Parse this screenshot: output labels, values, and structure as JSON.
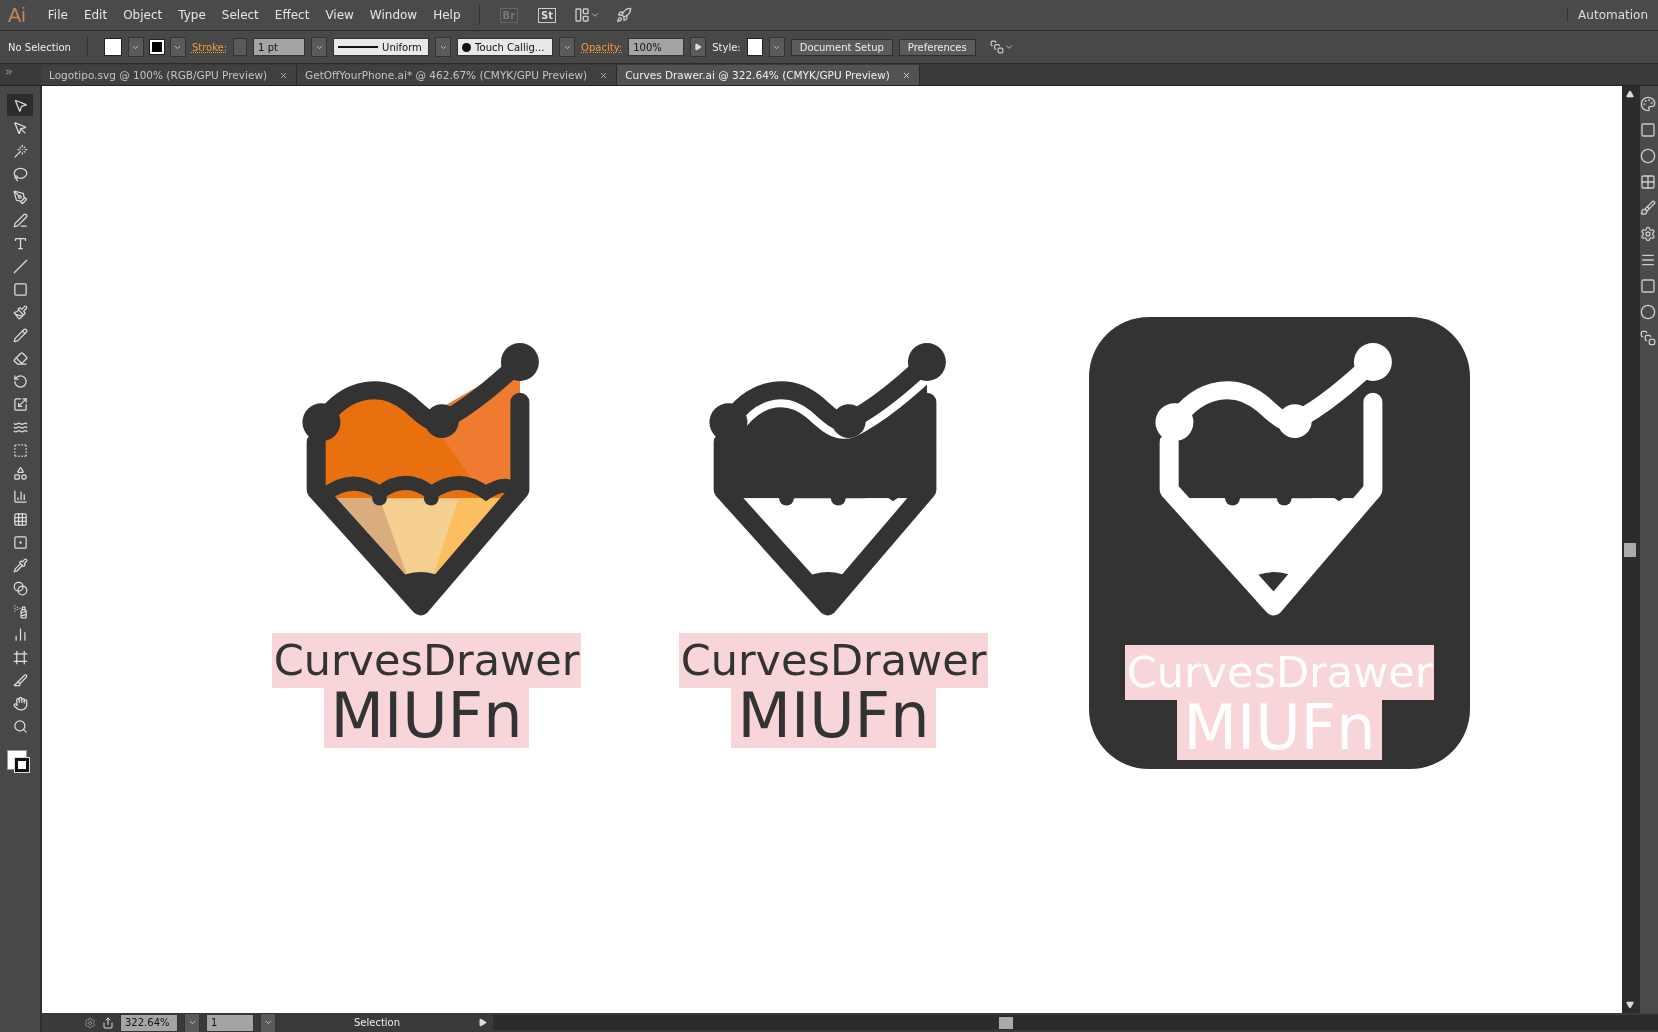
{
  "app": {
    "logo": "Ai",
    "workspace": "Automation"
  },
  "menu": [
    "File",
    "Edit",
    "Object",
    "Type",
    "Select",
    "Effect",
    "View",
    "Window",
    "Help"
  ],
  "bridge_buttons": [
    "Br",
    "St"
  ],
  "control_bar": {
    "selection": "No Selection",
    "stroke_label": "Stroke:",
    "stroke_weight": "1 pt",
    "profile": "Uniform",
    "brush": "Touch Callig...",
    "opacity_label": "Opacity:",
    "opacity": "100%",
    "style_label": "Style:",
    "buttons": [
      "Document Setup",
      "Preferences"
    ]
  },
  "tabs": [
    {
      "label": "Logotipo.svg @ 100% (RGB/GPU Preview)",
      "selected": false
    },
    {
      "label": "GetOffYourPhone.ai* @ 462.67% (CMYK/GPU Preview)",
      "selected": false
    },
    {
      "label": "Curves Drawer.ai @ 322.64% (CMYK/GPU Preview)",
      "selected": true
    }
  ],
  "tools": [
    {
      "selected": true
    },
    {
      "selected": false
    },
    {
      "selected": false
    },
    {
      "selected": false
    },
    {
      "selected": false
    },
    {
      "selected": false
    },
    {
      "selected": false
    },
    {
      "selected": false
    },
    {
      "selected": false
    },
    {
      "selected": false
    },
    {
      "selected": false
    },
    {
      "selected": false
    },
    {
      "selected": false
    },
    {
      "selected": false
    },
    {
      "selected": false
    },
    {
      "selected": false
    },
    {
      "selected": false
    },
    {
      "selected": false
    },
    {
      "selected": false
    },
    {
      "selected": false
    },
    {
      "selected": false
    },
    {
      "selected": false
    },
    {
      "selected": false
    },
    {
      "selected": false
    },
    {
      "selected": false
    },
    {
      "selected": false
    },
    {
      "selected": false
    },
    {
      "selected": false
    }
  ],
  "artworks": [
    {
      "kind": "color",
      "title": "CurvesDrawer",
      "subtitle": "MIUFn"
    },
    {
      "kind": "mono",
      "title": "CurvesDrawer",
      "subtitle": "MIUFn"
    },
    {
      "kind": "inverse",
      "title": "CurvesDrawer",
      "subtitle": "MIUFn"
    }
  ],
  "status_bar": {
    "zoom": "322.64%",
    "artboard": "1",
    "tool": "Selection"
  }
}
